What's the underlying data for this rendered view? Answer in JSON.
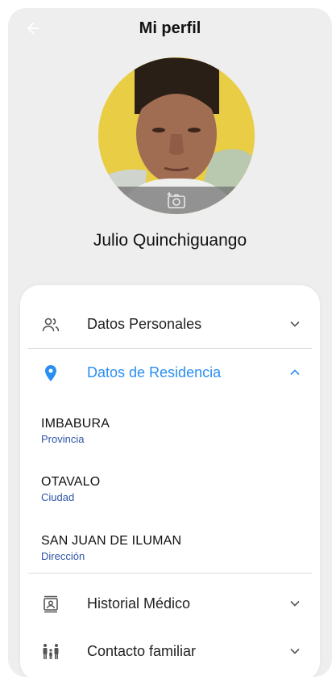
{
  "header": {
    "title": "Mi perfil"
  },
  "profile": {
    "name": "Julio Quinchiguango"
  },
  "sections": {
    "personal": {
      "label": "Datos Personales"
    },
    "residence": {
      "label": "Datos de Residencia",
      "fields": [
        {
          "value": "IMBABURA",
          "label": "Provincia"
        },
        {
          "value": "OTAVALO",
          "label": "Ciudad"
        },
        {
          "value": "SAN JUAN DE ILUMAN",
          "label": "Dirección"
        }
      ]
    },
    "medical": {
      "label": "Historial Médico"
    },
    "family": {
      "label": "Contacto familiar"
    }
  },
  "colors": {
    "accent": "#2a8ef0",
    "field_label": "#2e55a8",
    "background": "#eeeeee"
  }
}
